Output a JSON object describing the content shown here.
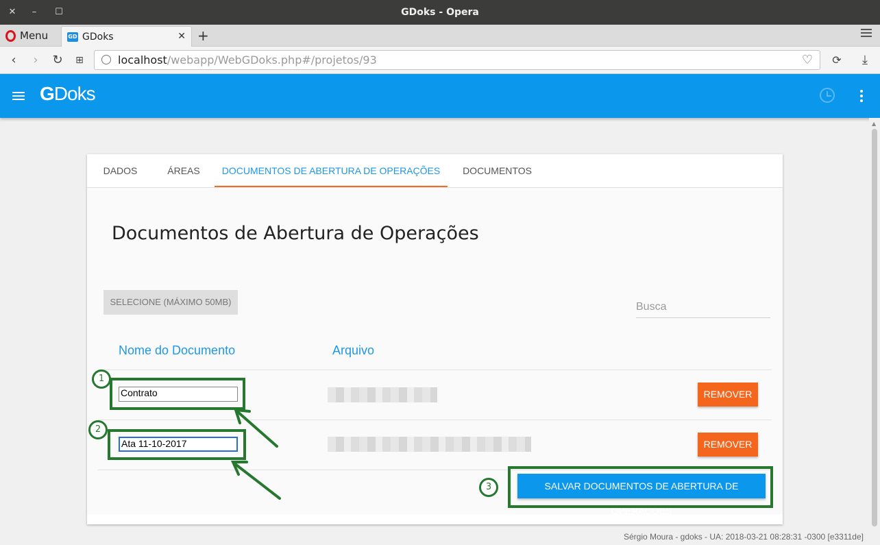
{
  "window": {
    "title": "GDoks - Opera"
  },
  "browser": {
    "menu_label": "Menu",
    "tab_title": "GDoks",
    "url_host": "localhost",
    "url_path": "/webapp/WebGDoks.php#/projetos/93"
  },
  "app": {
    "logo_g": "G",
    "logo_rest": "Doks"
  },
  "tabs": [
    {
      "label": "DADOS"
    },
    {
      "label": "ÁREAS"
    },
    {
      "label": "DOCUMENTOS DE ABERTURA DE OPERAÇÕES"
    },
    {
      "label": "DOCUMENTOS"
    }
  ],
  "page": {
    "title": "Documentos de Abertura de Operações",
    "select_button": "SELECIONE (MÁXIMO 50MB)",
    "search_placeholder": "Busca",
    "col_name": "Nome do Documento",
    "col_file": "Arquivo",
    "rows": [
      {
        "name": "Contrato",
        "remove_label": "REMOVER"
      },
      {
        "name": "Ata 11-10-2017",
        "remove_label": "REMOVER"
      }
    ],
    "save_button": "SALVAR DOCUMENTOS DE ABERTURA DE OPERAÇÕES"
  },
  "annotations": {
    "n1": "1",
    "n2": "2",
    "n3": "3",
    "color": "#26782f"
  },
  "footer": "Sérgio Moura - gdoks - UA: 2018-03-21 08:28:31 -0300 [e3311de]",
  "colors": {
    "primary": "#0b97ec",
    "accent": "#f4661d"
  }
}
